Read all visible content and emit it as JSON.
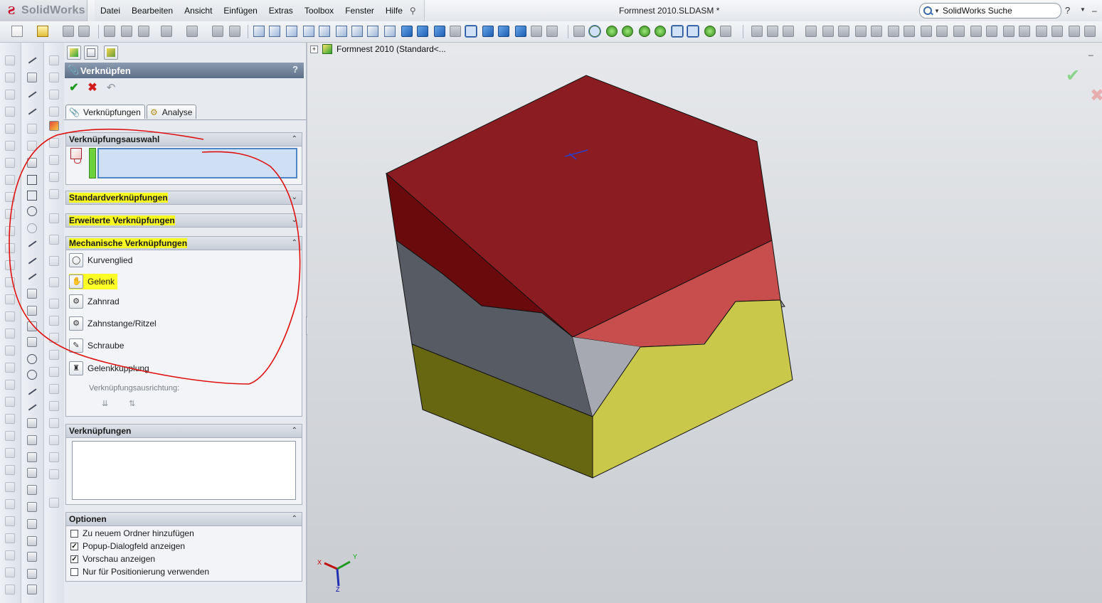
{
  "app": {
    "brand": "SolidWorks",
    "document_title": "Formnest 2010.SLDASM *",
    "search_placeholder": "SolidWorks Suche",
    "help_symbol": "?"
  },
  "menu": [
    "Datei",
    "Bearbeiten",
    "Ansicht",
    "Einfügen",
    "Extras",
    "Toolbox",
    "Fenster",
    "Hilfe"
  ],
  "property_manager": {
    "title": "Verknüpfen",
    "help": "?",
    "tabs": [
      {
        "label": "Verknüpfungen",
        "icon": "paperclip-icon"
      },
      {
        "label": "Analyse",
        "icon": "analysis-icon"
      }
    ],
    "groups": {
      "selection": "Verknüpfungsauswahl",
      "standard": "Standardverknüpfungen",
      "advanced": "Erweiterte Verknüpfungen",
      "mechanical": "Mechanische Verknüpfungen",
      "mates": "Verknüpfungen",
      "options": "Optionen"
    },
    "mechanical_mates": [
      {
        "label": "Kurvenglied",
        "icon": "cam-icon",
        "highlighted": false
      },
      {
        "label": "Gelenk",
        "icon": "hinge-icon",
        "highlighted": true
      },
      {
        "label": "Zahnrad",
        "icon": "gear-icon",
        "highlighted": false
      },
      {
        "label": "Zahnstange/Ritzel",
        "icon": "rack-pinion-icon",
        "highlighted": false
      },
      {
        "label": "Schraube",
        "icon": "screw-icon",
        "highlighted": false
      },
      {
        "label": "Gelenkkupplung",
        "icon": "universal-joint-icon",
        "highlighted": false
      }
    ],
    "mate_alignment_label": "Verknüpfungsausrichtung:",
    "options": [
      {
        "label": "Zu neuem Ordner hinzufügen",
        "checked": false
      },
      {
        "label": "Popup-Dialogfeld anzeigen",
        "checked": true
      },
      {
        "label": "Vorschau anzeigen",
        "checked": true
      },
      {
        "label": "Nur für Positionierung verwenden",
        "checked": false
      }
    ]
  },
  "graphics": {
    "tree_root": "Formnest 2010  (Standard<...",
    "triad_labels": {
      "x": "X",
      "y": "Y",
      "z": "Z"
    },
    "colors": {
      "top_face": "#8b1d22",
      "left_red": "#6b0a0c",
      "right_red": "#c84e4e",
      "left_gray": "#575b64",
      "right_gray": "#a6a9b1",
      "left_yellow": "#676611",
      "right_yellow": "#c9c84a"
    }
  },
  "annotations": {
    "highlight_color": "#ffff00",
    "circle_color": "#e01010"
  }
}
